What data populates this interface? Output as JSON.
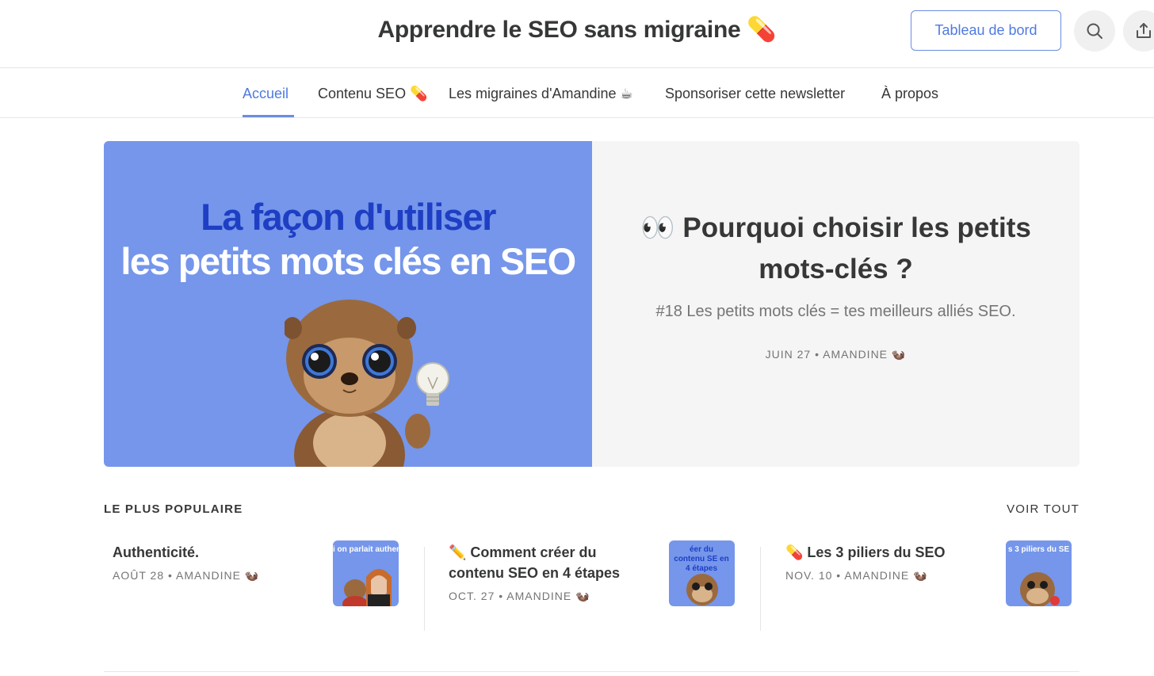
{
  "header": {
    "site_title": "Apprendre le SEO sans migraine 💊",
    "dashboard_label": "Tableau de bord"
  },
  "nav": {
    "items": [
      {
        "label": "Accueil",
        "active": true
      },
      {
        "label": "Contenu SEO 💊"
      },
      {
        "label": "Les migraines d'Amandine ☕"
      },
      {
        "label": "Sponsoriser cette newsletter"
      },
      {
        "label": "À propos"
      }
    ]
  },
  "hero": {
    "image_line1": "La façon d'utiliser",
    "image_line2": "les petits mots clés en SEO",
    "title": "👀 Pourquoi choisir les petits mots-clés ?",
    "subtitle": "#18 Les petits mots clés = tes meilleurs alliés SEO.",
    "meta": "JUIN 27 • AMANDINE 🦦"
  },
  "popular": {
    "header": "LE PLUS POPULAIRE",
    "see_all": "VOIR TOUT",
    "posts": [
      {
        "title": "Authenticité.",
        "meta": "AOÛT 28 • AMANDINE 🦦",
        "thumb_text": "i on parlait authentic"
      },
      {
        "title": "✏️ Comment créer du contenu SEO en 4 étapes",
        "meta": "OCT. 27 • AMANDINE 🦦",
        "thumb_text": "éer du contenu SE en 4 étapes"
      },
      {
        "title": "💊 Les 3 piliers du SEO",
        "meta": "NOV. 10 • AMANDINE 🦦",
        "thumb_text": "s 3 piliers du SE"
      }
    ]
  },
  "colors": {
    "accent": "#4f7ae0",
    "hero_bg": "#7596ea",
    "hero_dark_text": "#1e3fc4",
    "text": "#363737",
    "muted": "#757575"
  },
  "icons": [
    "search-icon",
    "share-icon",
    "otter-mascot",
    "lightbulb-icon"
  ]
}
